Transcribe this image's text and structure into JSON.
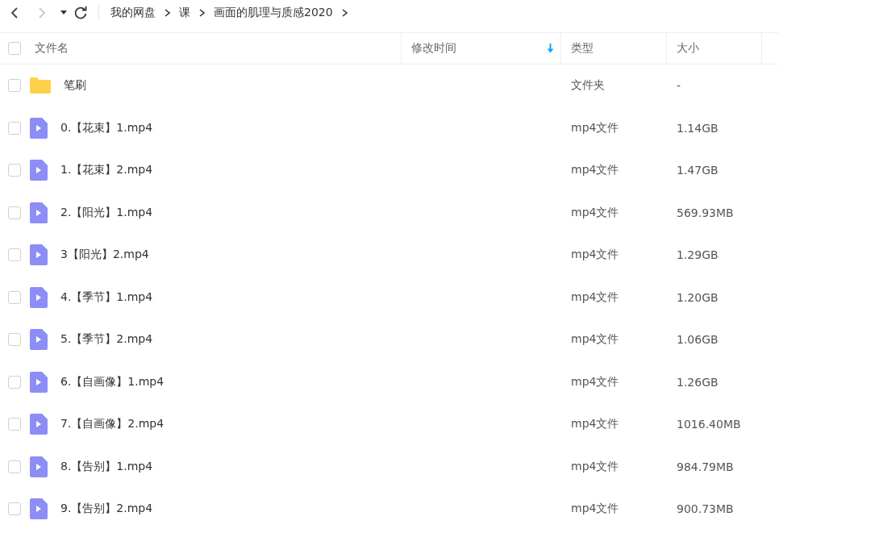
{
  "toolbar": {
    "back": {
      "disabled": false
    },
    "forward": {
      "disabled": true
    }
  },
  "breadcrumb": [
    "我的网盘",
    "课",
    "画面的肌理与质感2020"
  ],
  "table": {
    "columns": [
      {
        "label": "文件名",
        "sorted": false
      },
      {
        "label": "修改时间",
        "sorted": true
      },
      {
        "label": "类型",
        "sorted": false
      },
      {
        "label": "大小",
        "sorted": false
      }
    ],
    "select_all": {
      "checked": false
    },
    "rows": [
      {
        "kind": "folder",
        "name": "笔刷",
        "type": "文件夹",
        "size": "-",
        "checked": false
      },
      {
        "kind": "video",
        "name": "0.【花束】1.mp4",
        "type": "mp4文件",
        "size": "1.14GB",
        "checked": false
      },
      {
        "kind": "video",
        "name": "1.【花束】2.mp4",
        "type": "mp4文件",
        "size": "1.47GB",
        "checked": false
      },
      {
        "kind": "video",
        "name": "2.【阳光】1.mp4",
        "type": "mp4文件",
        "size": "569.93MB",
        "checked": false
      },
      {
        "kind": "video",
        "name": "3【阳光】2.mp4",
        "type": "mp4文件",
        "size": "1.29GB",
        "checked": false
      },
      {
        "kind": "video",
        "name": "4.【季节】1.mp4",
        "type": "mp4文件",
        "size": "1.20GB",
        "checked": false
      },
      {
        "kind": "video",
        "name": "5.【季节】2.mp4",
        "type": "mp4文件",
        "size": "1.06GB",
        "checked": false
      },
      {
        "kind": "video",
        "name": "6.【自画像】1.mp4",
        "type": "mp4文件",
        "size": "1.26GB",
        "checked": false
      },
      {
        "kind": "video",
        "name": "7.【自画像】2.mp4",
        "type": "mp4文件",
        "size": "1016.40MB",
        "checked": false
      },
      {
        "kind": "video",
        "name": "8.【告别】1.mp4",
        "type": "mp4文件",
        "size": "984.79MB",
        "checked": false
      },
      {
        "kind": "video",
        "name": "9.【告别】2.mp4",
        "type": "mp4文件",
        "size": "900.73MB",
        "checked": false
      }
    ]
  }
}
